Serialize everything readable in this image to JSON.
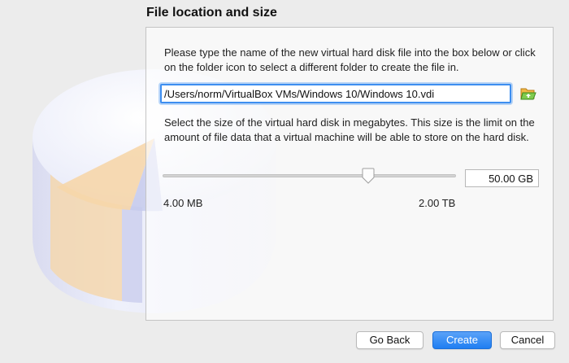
{
  "section": {
    "title": "File location and size"
  },
  "location": {
    "description": "Please type the name of the new virtual hard disk file into the box below or click on the folder icon to select a different folder to create the file in.",
    "path_value": "/Users/norm/VirtualBox VMs/Windows 10/Windows 10.vdi",
    "folder_icon": "folder-open-icon"
  },
  "size": {
    "description": "Select the size of the virtual hard disk in megabytes. This size is the limit on the amount of file data that a virtual machine will be able to store on the hard disk.",
    "value_text": "50.00 GB",
    "min_label": "4.00 MB",
    "max_label": "2.00 TB",
    "slider_fraction": 0.7
  },
  "buttons": {
    "back": "Go Back",
    "create": "Create",
    "cancel": "Cancel"
  },
  "colors": {
    "accent": "#3d8ef0",
    "primary_button": "#2a86f5",
    "panel_border": "#c4c4c4"
  }
}
